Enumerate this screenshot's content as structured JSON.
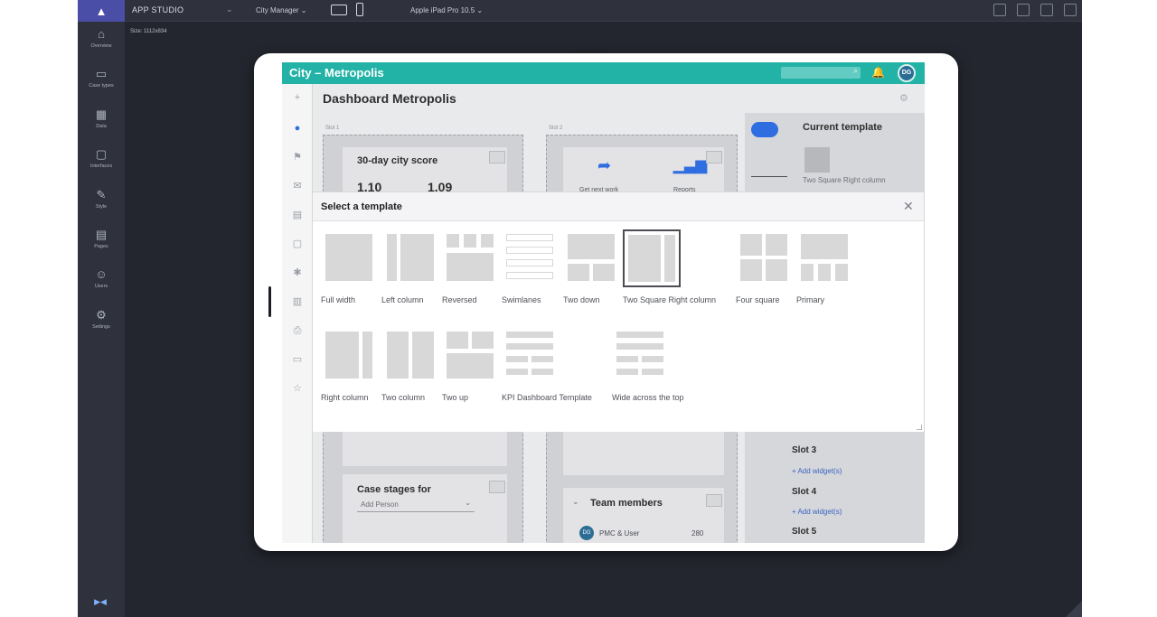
{
  "studio": {
    "logo": "▲",
    "title": "APP STUDIO",
    "title_caret": "⌄",
    "case_select": "City Manager ⌄",
    "device_name": "Apple iPad Pro 10.5 ⌄",
    "size_label": "Size: 1112x834",
    "nav": [
      {
        "icon": "⌂",
        "label": "Overview"
      },
      {
        "icon": "▭",
        "label": "Case types"
      },
      {
        "icon": "▦",
        "label": "Data"
      },
      {
        "icon": "▢",
        "label": "Interfaces"
      },
      {
        "icon": "✎",
        "label": "Style"
      },
      {
        "icon": "▤",
        "label": "Pages"
      },
      {
        "icon": "☺",
        "label": "Users"
      },
      {
        "icon": "⚙",
        "label": "Settings"
      }
    ],
    "bottom_icon": "▶◀"
  },
  "app": {
    "title": "City – Metropolis",
    "search_icon": "⌕",
    "bell_icon": "🔔",
    "avatar_initials": "DG",
    "dashboard_title": "Dashboard Metropolis",
    "rail_icons": [
      "+",
      "●",
      "⚑",
      "✉",
      "▤",
      "▢",
      "✱",
      "▥",
      "⎙",
      "▭",
      "☆"
    ],
    "slot1_label": "Slot 1",
    "slot2_label": "Slot 2",
    "score_card_title": "30-day city score",
    "score_a": "1.10",
    "score_b": "1.09",
    "share_label": "Get next work",
    "chart_label": "Reports",
    "case_stages_title": "Case stages for",
    "case_stages_select": "Add Person",
    "case_stages_caret": "⌄",
    "team_title": "Team members",
    "team_member_initials": "DG",
    "team_member_name": "PMC & User",
    "team_member_count": "280",
    "current_template_title": "Current template",
    "current_template_name": "Two Square Right column",
    "slot3": "Slot 3",
    "slot4": "Slot 4",
    "slot5": "Slot 5",
    "add_widget": "+ Add widget(s)"
  },
  "modal": {
    "title": "Select a template",
    "close": "✕",
    "templates": [
      {
        "name": "Full width"
      },
      {
        "name": "Left column"
      },
      {
        "name": "Reversed"
      },
      {
        "name": "Swimlanes"
      },
      {
        "name": "Two down"
      },
      {
        "name": "Two Square Right column",
        "selected": true
      },
      {
        "name": "Four square"
      },
      {
        "name": "Primary"
      },
      {
        "name": "Right column"
      },
      {
        "name": "Two column"
      },
      {
        "name": "Two up"
      },
      {
        "name": "KPI Dashboard Template"
      },
      {
        "name": "Wide across the top"
      }
    ]
  }
}
